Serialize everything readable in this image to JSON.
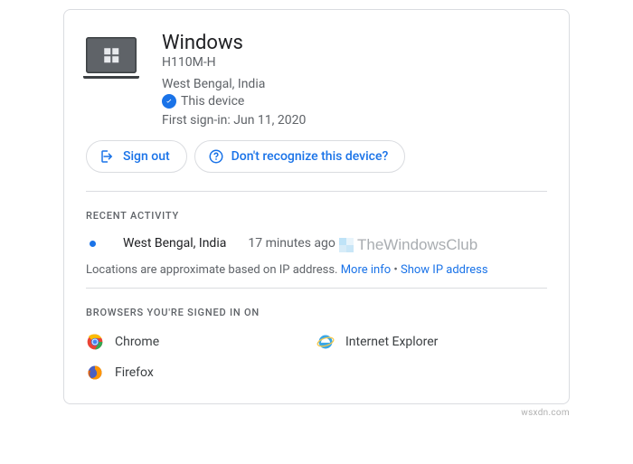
{
  "device": {
    "os": "Windows",
    "model": "H110M-H",
    "location": "West Bengal, India",
    "this_device_label": "This device",
    "first_signin_label": "First sign-in: Jun 11, 2020"
  },
  "buttons": {
    "sign_out": "Sign out",
    "dont_recognize": "Don't recognize this device?"
  },
  "recent": {
    "heading": "Recent Activity",
    "watermark": "TheWindowsClub",
    "items": [
      {
        "location": "West Bengal, India",
        "time": "17 minutes ago"
      }
    ],
    "disclaimer": "Locations are approximate based on IP address.",
    "more_info": "More info",
    "show_ip": "Show IP address"
  },
  "browsers": {
    "heading": "Browsers you're signed in on",
    "items": [
      {
        "name": "Chrome"
      },
      {
        "name": "Internet Explorer"
      },
      {
        "name": "Firefox"
      }
    ]
  },
  "attribution": "wsxdn.com"
}
